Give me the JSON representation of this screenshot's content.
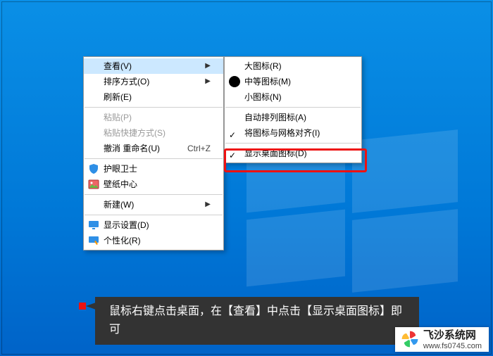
{
  "menu1": {
    "view": {
      "label": "查看(V)"
    },
    "sort": {
      "label": "排序方式(O)"
    },
    "refresh": {
      "label": "刷新(E)"
    },
    "paste": {
      "label": "粘贴(P)"
    },
    "paste_short": {
      "label": "粘贴快捷方式(S)"
    },
    "undo": {
      "label": "撤消 重命名(U)",
      "shortcut": "Ctrl+Z"
    },
    "eye_guard": {
      "label": "护眼卫士"
    },
    "wallpaper": {
      "label": "壁纸中心"
    },
    "new": {
      "label": "新建(W)"
    },
    "display": {
      "label": "显示设置(D)"
    },
    "personalize": {
      "label": "个性化(R)"
    }
  },
  "menu2": {
    "large": {
      "label": "大图标(R)"
    },
    "medium": {
      "label": "中等图标(M)"
    },
    "small": {
      "label": "小图标(N)"
    },
    "auto": {
      "label": "自动排列图标(A)"
    },
    "align": {
      "label": "将图标与网格对齐(I)"
    },
    "showdesk": {
      "label": "显示桌面图标(D)"
    }
  },
  "caption": "鼠标右键点击桌面，在【查看】中点击【显示桌面图标】即可",
  "watermark": {
    "title": "飞沙系统网",
    "url": "www.fs0745.com"
  }
}
